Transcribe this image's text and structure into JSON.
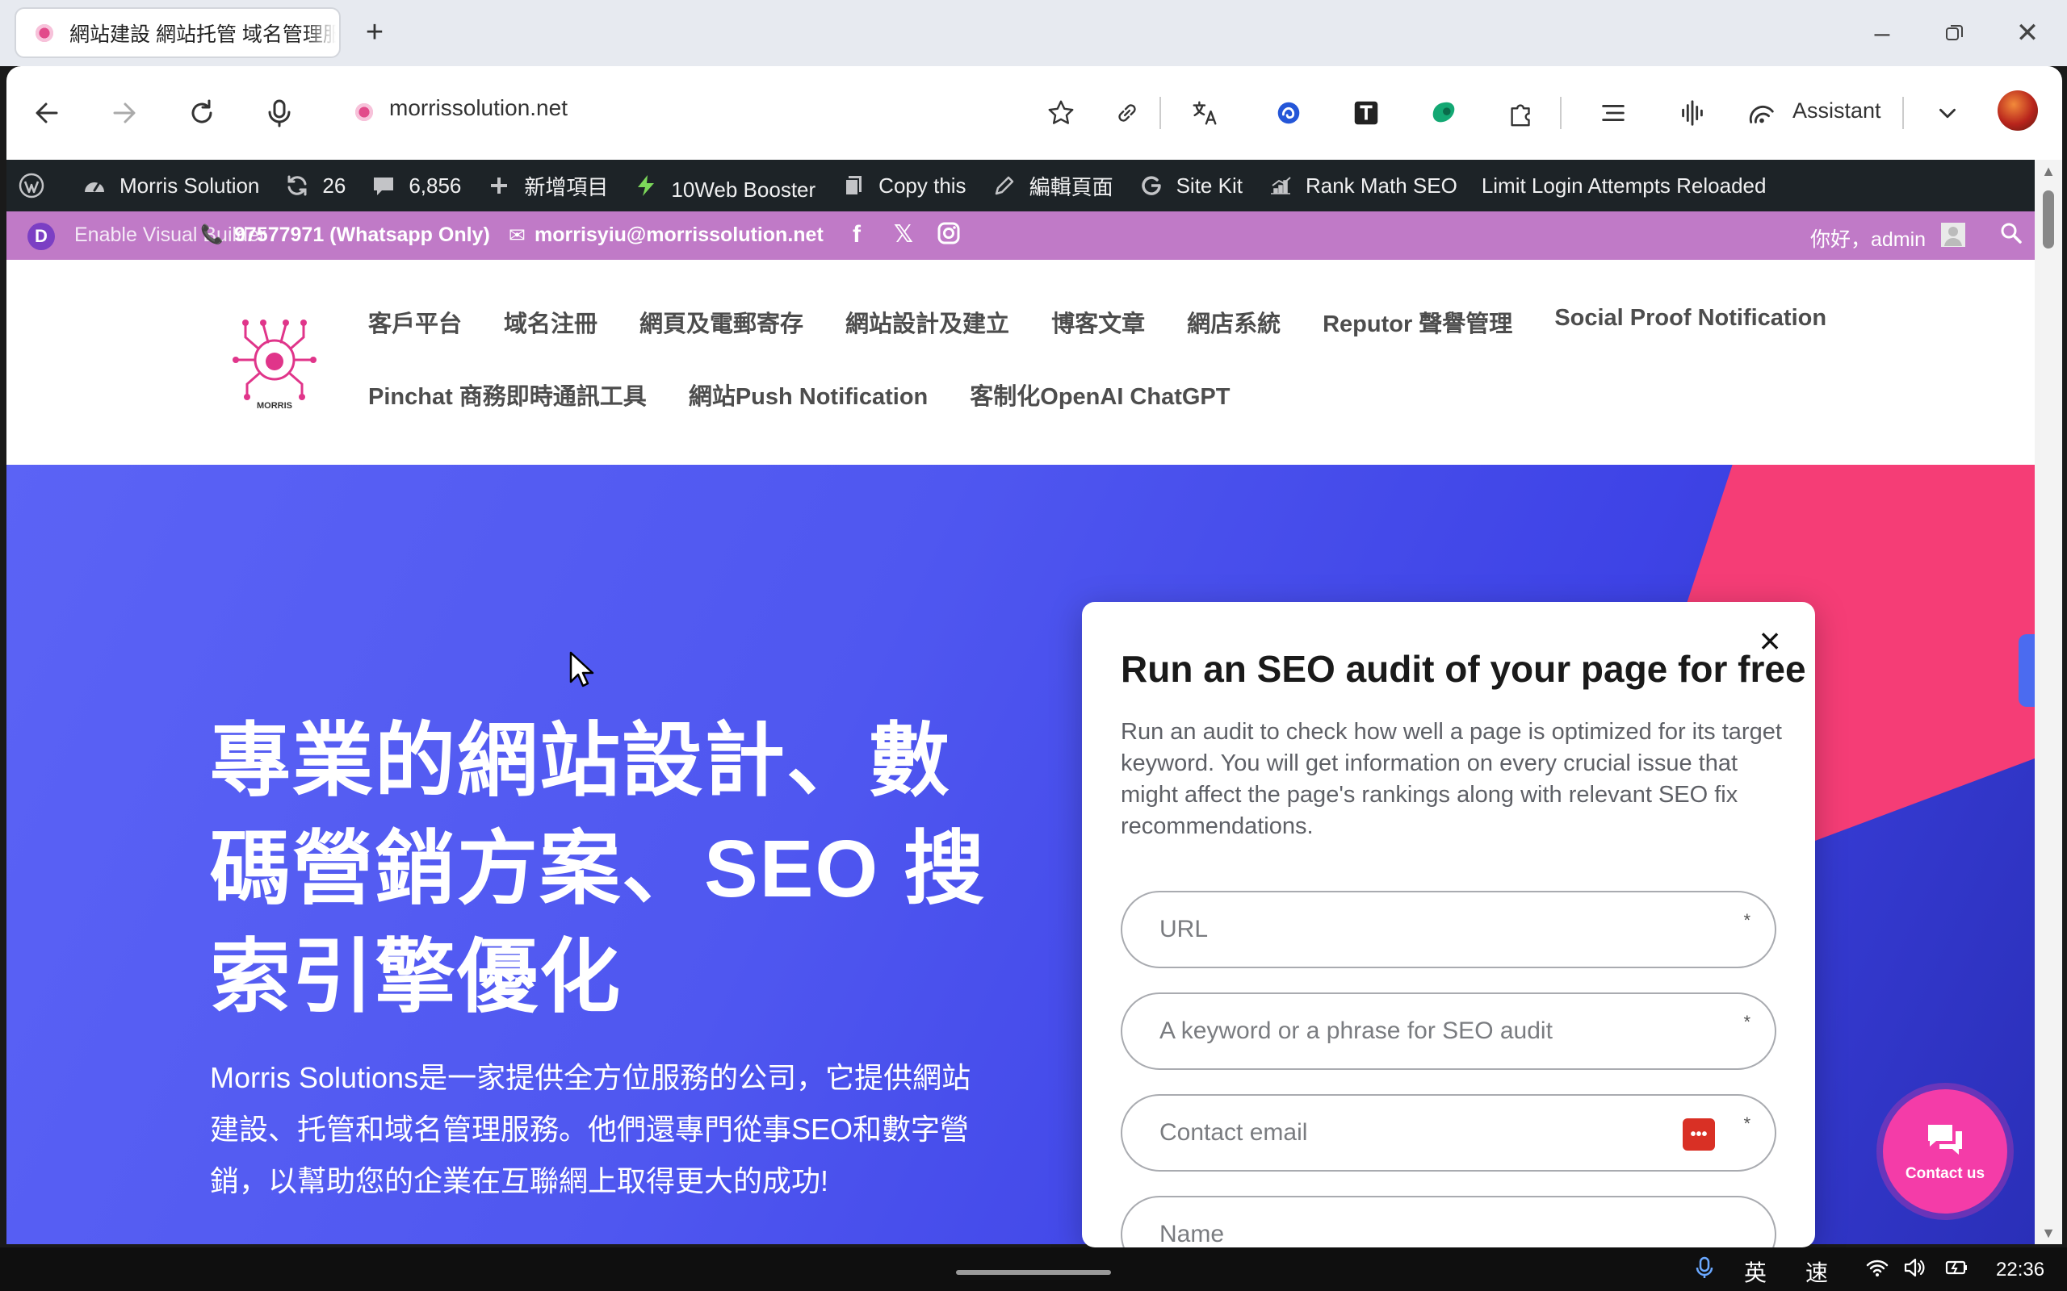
{
  "browser": {
    "tab_title": "網站建設 網站托管 域名管理服務",
    "new_tab": "+",
    "url": "morrissolution.net",
    "assistant_label": "Assistant"
  },
  "wpbar": {
    "site_name": "Morris Solution",
    "updates_count": "26",
    "comments_count": "6,856",
    "new_item": "新增項目",
    "booster": "10Web Booster",
    "copy_this": "Copy this",
    "edit_page": "編輯頁面",
    "site_kit": "Site Kit",
    "rank_math": "Rank Math SEO",
    "limit_login": "Limit Login Attempts Reloaded"
  },
  "topbar": {
    "divi_badge": "D",
    "enable_visual": "Enable Visual Builder",
    "phone": "97577971 (Whatsapp Only)",
    "email": "morrisyiu@morrissolution.net",
    "greeting": "你好，admin"
  },
  "menu": {
    "row1": [
      "客戶平台",
      "域名注冊",
      "網頁及電郵寄存",
      "網站設計及建立",
      "博客文章",
      "網店系統",
      "Reputor 聲譽管理",
      "Social Proof Notification"
    ],
    "row2": [
      "Pinchat 商務即時通訊工具",
      "網站Push Notification",
      "客制化OpenAI ChatGPT"
    ]
  },
  "logo_text": "MORRIS",
  "hero": {
    "title": "專業的網站設計、數碼營銷方案、SEO 搜索引擎優化",
    "description": "Morris Solutions是一家提供全方位服務的公司，它提供網站建設、托管和域名管理服務。他們還專門從事SEO和數字營銷，以幫助您的企業在互聯網上取得更大的成功!"
  },
  "popup": {
    "title": "Run an SEO audit of your page for free",
    "description": "Run an audit to check how well a page is optimized for its target keyword. You will get information on every crucial issue that might affect the page's rankings along with relevant SEO fix recommendations.",
    "fields": {
      "url_placeholder": "URL",
      "keyword_placeholder": "A keyword or a phrase for SEO audit",
      "email_placeholder": "Contact email",
      "name_placeholder": "Name"
    },
    "required_mark": "*",
    "close": "×"
  },
  "chat": {
    "label": "Contact us"
  },
  "taskbar": {
    "ime_lang": "英",
    "ime_mode": "速",
    "time": "22:36"
  },
  "colors": {
    "wpbar_bg": "#1d2327",
    "topbar_bg": "#c07ac7",
    "hero_blue": "#4f57f0",
    "hero_pink": "#f53d76",
    "chat_pink": "#f43ca8"
  }
}
